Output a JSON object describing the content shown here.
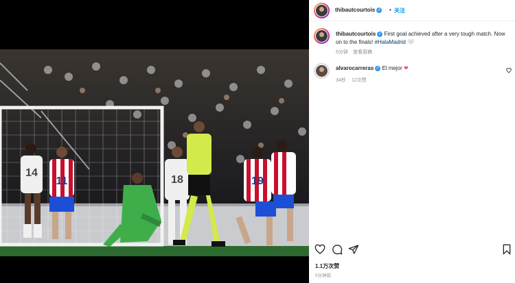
{
  "header": {
    "username": "thibautcourtois",
    "verified_icon": "verified-icon",
    "follow_label": "关注"
  },
  "caption": {
    "username": "thibautcourtois",
    "text": "First goal achieved after a very tough match. Now on to the finals!",
    "hashtag": "#HalaMadrid",
    "emoji": "🤍",
    "time": "5分钟",
    "translate": "查看原稿"
  },
  "comments": [
    {
      "username": "alvarocarreras",
      "text": "El mejor",
      "emoji": "❤",
      "time": "34秒",
      "likes": "12次赞"
    }
  ],
  "post": {
    "likes": "1.1万次赞",
    "time": "5分钟前"
  },
  "photo": {
    "jersey_numbers": [
      "14",
      "11",
      "18",
      "19"
    ],
    "colors": {
      "pitch": "#2d6a2f",
      "crowd": "#1e1e22",
      "atleti_red": "#c8102e",
      "keeper_green": "#3fae4a",
      "ref_yellow": "#d4e94a"
    }
  }
}
